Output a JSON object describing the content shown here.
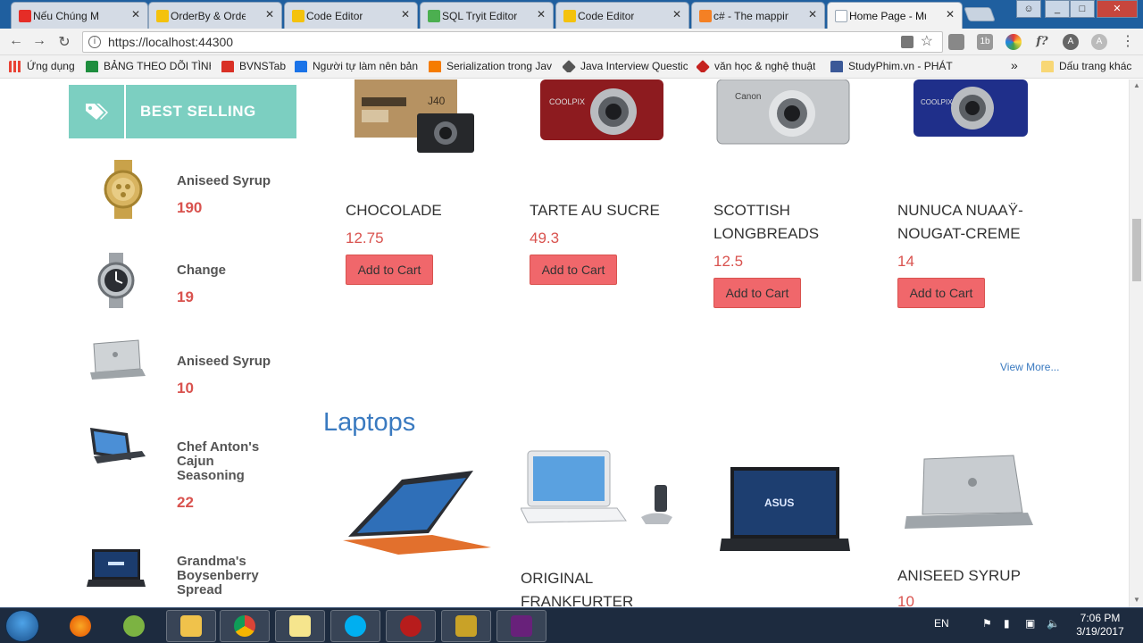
{
  "browser": {
    "tabs": [
      {
        "label": "Nếu Chúng M",
        "icon": "youtube-icon",
        "color": "#e52d27"
      },
      {
        "label": "OrderBy & Order",
        "icon": "page-icon",
        "color": "#f4c20d"
      },
      {
        "label": "Code Editor",
        "icon": "page-icon",
        "color": "#f4c20d"
      },
      {
        "label": "SQL Tryit Editor v",
        "icon": "w3-icon",
        "color": "#4caf50"
      },
      {
        "label": "Code Editor",
        "icon": "page-icon",
        "color": "#f4c20d"
      },
      {
        "label": "c# - The mapping",
        "icon": "stackoverflow-icon",
        "color": "#f48024"
      },
      {
        "label": "Home Page - Mu",
        "icon": "document-icon",
        "color": "#9aa7b5"
      }
    ],
    "close_glyph": "✕",
    "url": "https://localhost:44300",
    "bookmarks": [
      {
        "label": "Ứng dụng",
        "color": "#e94235"
      },
      {
        "label": "BẢNG THEO DÕI TÌNH",
        "color": "#1e8e3e"
      },
      {
        "label": "BVNSTab",
        "color": "#d93025"
      },
      {
        "label": "Người tự làm nên bản",
        "color": "#1a73e8"
      },
      {
        "label": "Serialization trong Jav",
        "color": "#f57c00"
      },
      {
        "label": "Java Interview Questic",
        "color": "#555555"
      },
      {
        "label": "văn học & nghệ thuật",
        "color": "#c5221f"
      },
      {
        "label": "StudyPhim.vn - PHÁT",
        "color": "#3b5998"
      }
    ],
    "bookmarks_overflow": "»",
    "other_bookmarks": "Dấu trang khác"
  },
  "sidebar": {
    "title": "BEST SELLING",
    "items": [
      {
        "name": "Aniseed Syrup",
        "price": "190",
        "image": "gold-watch"
      },
      {
        "name": "Change",
        "price": "19",
        "image": "steel-watch"
      },
      {
        "name": "Aniseed Syrup",
        "price": "10",
        "image": "silver-laptop"
      },
      {
        "name": "Chef Anton's Cajun Seasoning",
        "price": "22",
        "image": "convertible-laptop"
      },
      {
        "name": "Grandma's Boysenberry Spread",
        "price": "",
        "image": "asus-laptop"
      }
    ]
  },
  "products_row1": [
    {
      "name": "CHOCOLADE",
      "price": "12.75",
      "button": "Add to Cart",
      "image": "fujifilm-camera"
    },
    {
      "name": "TARTE AU SUCRE",
      "price": "49.3",
      "button": "Add to Cart",
      "image": "red-nikon-camera"
    },
    {
      "name": "SCOTTISH LONGBREADS",
      "price": "12.5",
      "button": "Add to Cart",
      "image": "silver-canon-camera"
    },
    {
      "name": "NUNUCA NUAAŸ-NOUGAT-CREME",
      "price": "14",
      "button": "Add to Cart",
      "image": "blue-nikon-camera"
    }
  ],
  "view_more": "View More...",
  "laptops_title": "Laptops",
  "products_row2": [
    {
      "name": "",
      "price": "",
      "image": "orange-lenovo-yoga"
    },
    {
      "name": "ORIGINAL FRANKFURTER",
      "price": "",
      "image": "white-laptop-phone"
    },
    {
      "name": "",
      "price": "",
      "image": "black-asus-laptop"
    },
    {
      "name": "ANISEED SYRUP",
      "price": "10",
      "image": "silver-dell-laptop"
    }
  ],
  "taskbar": {
    "apps": [
      "firefox-icon",
      "unikey-icon",
      "explorer-icon",
      "chrome-icon",
      "notes-icon",
      "skype-icon",
      "spy-icon",
      "tools-icon",
      "visual-studio-icon"
    ],
    "lang": "EN",
    "time": "7:06 PM",
    "date": "3/19/2017"
  }
}
